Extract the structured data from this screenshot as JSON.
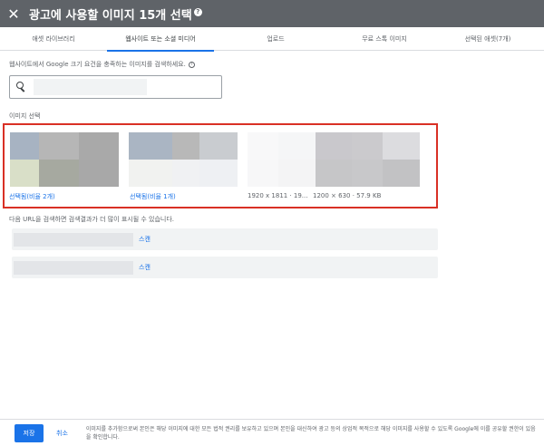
{
  "header": {
    "title": "광고에 사용할 이미지 15개 선택",
    "close_icon": "close-icon",
    "help_icon": "help-icon",
    "background_color": "#5f6368"
  },
  "tabs": [
    {
      "label": "애셋 라이브러리",
      "active": false
    },
    {
      "label": "웹사이트 또는 소셜 미디어",
      "active": true
    },
    {
      "label": "업로드",
      "active": false
    },
    {
      "label": "무료 스톡 이미지",
      "active": false
    },
    {
      "label": "선택된 애셋(7개)",
      "active": false
    }
  ],
  "search": {
    "help_text": "웹사이트에서 Google 크기 요건을 충족하는 이미지를 검색하세요.",
    "help_icon": "question-icon",
    "search_icon": "search-icon",
    "value": ""
  },
  "images_section": {
    "label": "이미지 선택",
    "outline_color": "#d93025",
    "items": [
      {
        "caption": "선택됨(비율 2개)",
        "state": "selected"
      },
      {
        "caption": "선택됨(비율 1개)",
        "state": "selected"
      },
      {
        "caption": "1920 x 1811 · 19...",
        "state": "available"
      },
      {
        "caption": "1200 × 630 · 57.9 KB",
        "state": "available"
      }
    ]
  },
  "url_section": {
    "notice": "다음 URL을 검색하면 검색결과가 더 많이 표시될 수 있습니다.",
    "rows": [
      {
        "scan_label": "스캔"
      },
      {
        "scan_label": "스캔"
      }
    ]
  },
  "footer": {
    "save_label": "저장",
    "cancel_label": "취소",
    "legal_text": "이미지를 추가함으로써 본인은 해당 이미지에 대한 모든 법적 권리를 보유하고 있으며 본인을 대신하여 광고 등의 상업적 목적으로 해당 이미지를 사용할 수 있도록 Google에 이를 공유할 권한이 있음을 확인합니다.",
    "accent_color": "#1a73e8"
  }
}
